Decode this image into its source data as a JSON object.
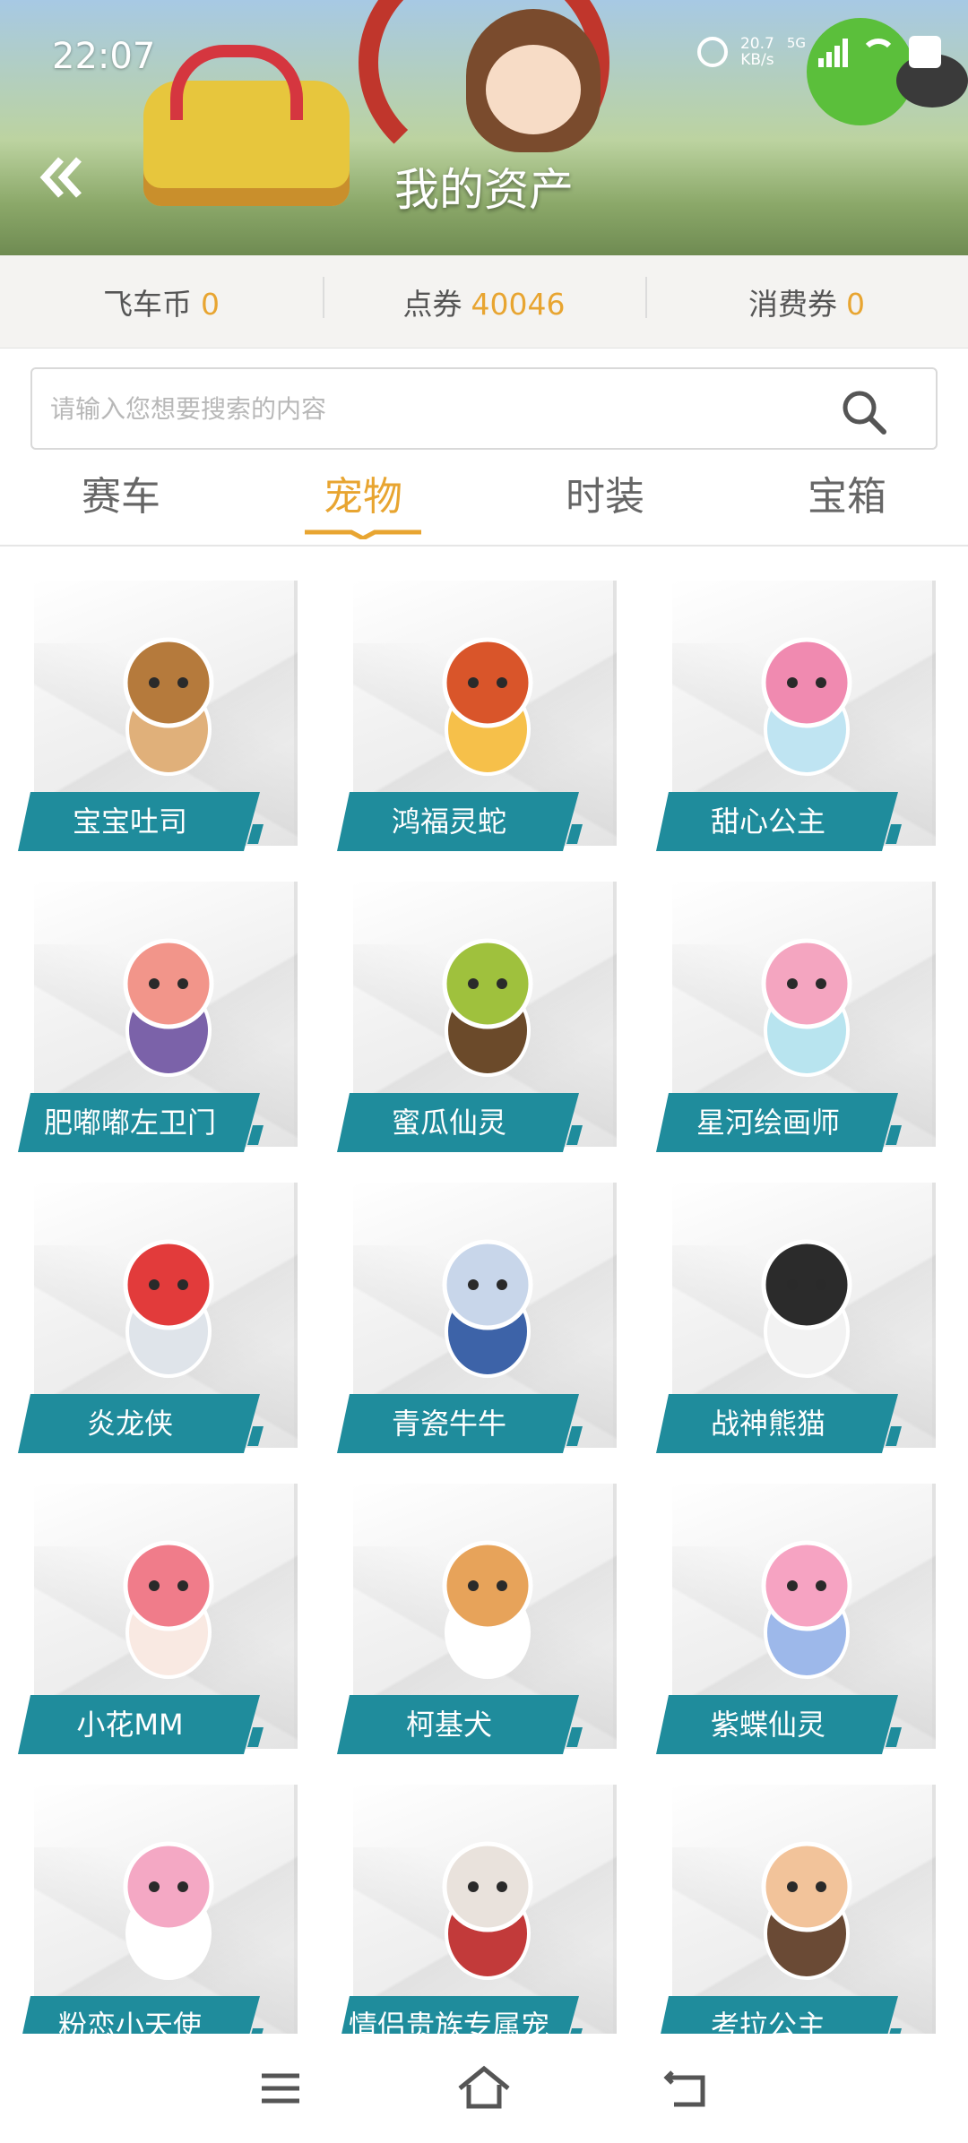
{
  "status_bar": {
    "time": "22:07",
    "speed_value": "20.7",
    "speed_unit": "KB/s",
    "network": "5G"
  },
  "header": {
    "title": "我的资产",
    "back_icon": "double-chevron-left-icon"
  },
  "assets": [
    {
      "label": "飞车币",
      "value": "0"
    },
    {
      "label": "点券",
      "value": "40046"
    },
    {
      "label": "消费券",
      "value": "0"
    }
  ],
  "search": {
    "placeholder": "请输入您想要搜索的内容",
    "value": ""
  },
  "tabs": [
    {
      "label": "赛车",
      "active": false
    },
    {
      "label": "宠物",
      "active": true
    },
    {
      "label": "时装",
      "active": false
    },
    {
      "label": "宝箱",
      "active": false
    }
  ],
  "pets": [
    {
      "name": "宝宝吐司",
      "icon": "toast-cookie"
    },
    {
      "name": "鸿福灵蛇",
      "icon": "lucky-snake"
    },
    {
      "name": "甜心公主",
      "icon": "sweet-princess"
    },
    {
      "name": "肥嘟嘟左卫门",
      "icon": "pig-character"
    },
    {
      "name": "蜜瓜仙灵",
      "icon": "melon-sprite"
    },
    {
      "name": "星河绘画师",
      "icon": "star-painter"
    },
    {
      "name": "炎龙侠",
      "icon": "flame-hero"
    },
    {
      "name": "青瓷牛牛",
      "icon": "porcelain-cow"
    },
    {
      "name": "战神熊猫",
      "icon": "panda-warrior"
    },
    {
      "name": "小花MM",
      "icon": "flower-girl"
    },
    {
      "name": "柯基犬",
      "icon": "corgi-dog"
    },
    {
      "name": "紫蝶仙灵",
      "icon": "butterfly-fairy"
    },
    {
      "name": "粉恋小天使",
      "icon": "pink-angel"
    },
    {
      "name": "情侣贵族专属宠",
      "icon": "couple-noble-pet"
    },
    {
      "name": "考拉公主",
      "icon": "koala-princess"
    }
  ],
  "colors": {
    "accent": "#e8a531",
    "label_bg": "#1f8c9c",
    "assets_bg": "#f4f3f1"
  },
  "navbar": {
    "items": [
      "menu-icon",
      "home-icon",
      "back-icon"
    ]
  }
}
